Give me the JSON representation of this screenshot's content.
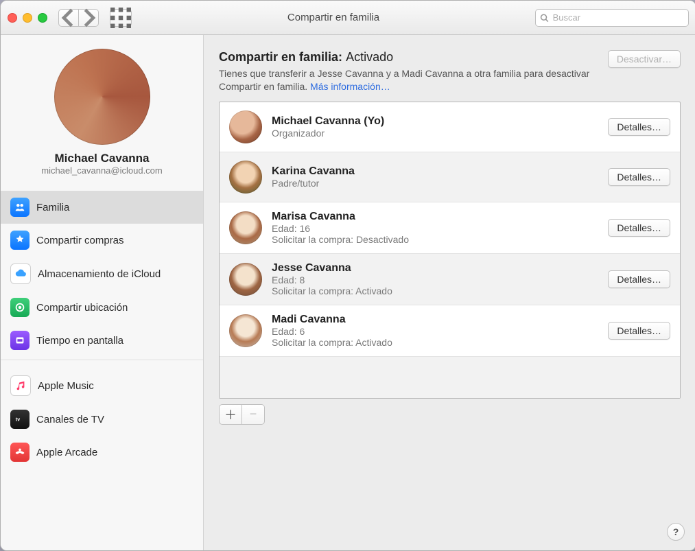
{
  "window": {
    "title": "Compartir en familia",
    "search_placeholder": "Buscar"
  },
  "sidebar": {
    "user_name": "Michael Cavanna",
    "user_email": "michael_cavanna@icloud.com",
    "items1": [
      {
        "label": "Familia",
        "icon": "family-icon",
        "selected": true
      },
      {
        "label": "Compartir compras",
        "icon": "appstore-icon"
      },
      {
        "label": "Almacenamiento de iCloud",
        "icon": "cloud-icon"
      },
      {
        "label": "Compartir ubicación",
        "icon": "location-icon"
      },
      {
        "label": "Tiempo en pantalla",
        "icon": "screentime-icon"
      }
    ],
    "items2": [
      {
        "label": "Apple Music",
        "icon": "music-icon"
      },
      {
        "label": "Canales de TV",
        "icon": "tv-icon"
      },
      {
        "label": "Apple Arcade",
        "icon": "arcade-icon"
      }
    ]
  },
  "main": {
    "heading_prefix": "Compartir en familia:",
    "heading_state": "Activado",
    "deactivate_label": "Desactivar…",
    "description": "Tienes que transferir a Jesse Cavanna y a Madi Cavanna a otra familia para desactivar Compartir en familia.",
    "more_info": "Más información…",
    "details_label": "Detalles…",
    "age_label": "Edad:",
    "ask_label": "Solicitar la compra:",
    "members": [
      {
        "name": "Michael Cavanna (Yo)",
        "role": "Organizador"
      },
      {
        "name": "Karina Cavanna",
        "role": "Padre/tutor"
      },
      {
        "name": "Marisa Cavanna",
        "age": "16",
        "ask": "Desactivado"
      },
      {
        "name": "Jesse Cavanna",
        "age": "8",
        "ask": "Activado"
      },
      {
        "name": "Madi Cavanna",
        "age": "6",
        "ask": "Activado"
      }
    ]
  }
}
